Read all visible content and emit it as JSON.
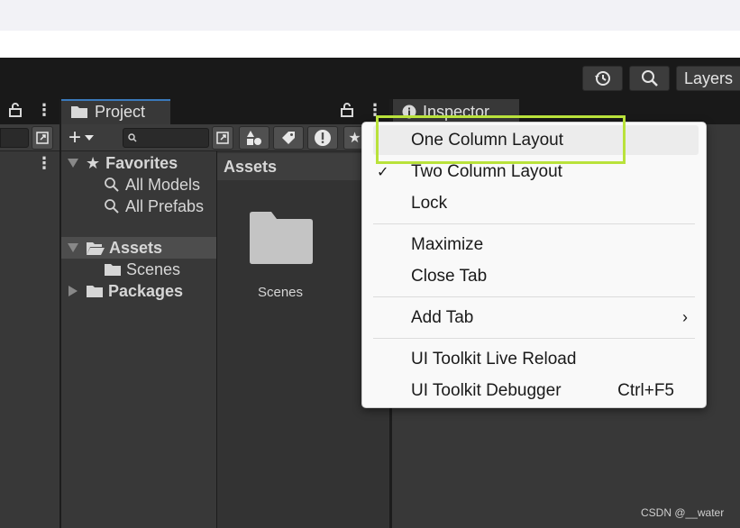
{
  "toolbar": {
    "history_icon": "history-icon",
    "search_icon": "search-icon",
    "layers_label": "Layers"
  },
  "tabs": {
    "project_label": "Project",
    "inspector_label": "Inspector"
  },
  "tree": {
    "favorites": "Favorites",
    "all_models": "All Models",
    "all_prefabs": "All Prefabs",
    "assets": "Assets",
    "scenes": "Scenes",
    "packages": "Packages"
  },
  "grid": {
    "header": "Assets",
    "items": [
      {
        "label": "Scenes"
      }
    ]
  },
  "context_menu": {
    "items": [
      {
        "label": "One Column Layout",
        "checked": false
      },
      {
        "label": "Two Column Layout",
        "checked": true
      },
      {
        "label": "Lock",
        "checked": false
      },
      {
        "label": "Maximize"
      },
      {
        "label": "Close Tab"
      },
      {
        "label": "Add Tab",
        "submenu": true
      },
      {
        "label": "UI Toolkit Live Reload"
      },
      {
        "label": "UI Toolkit Debugger",
        "shortcut": "Ctrl+F5"
      }
    ],
    "check_glyph": "✓",
    "submenu_glyph": "›"
  },
  "colors": {
    "highlight": "#b9e23b",
    "tab_accent": "#3a79bb"
  },
  "watermark": "CSDN @__water"
}
